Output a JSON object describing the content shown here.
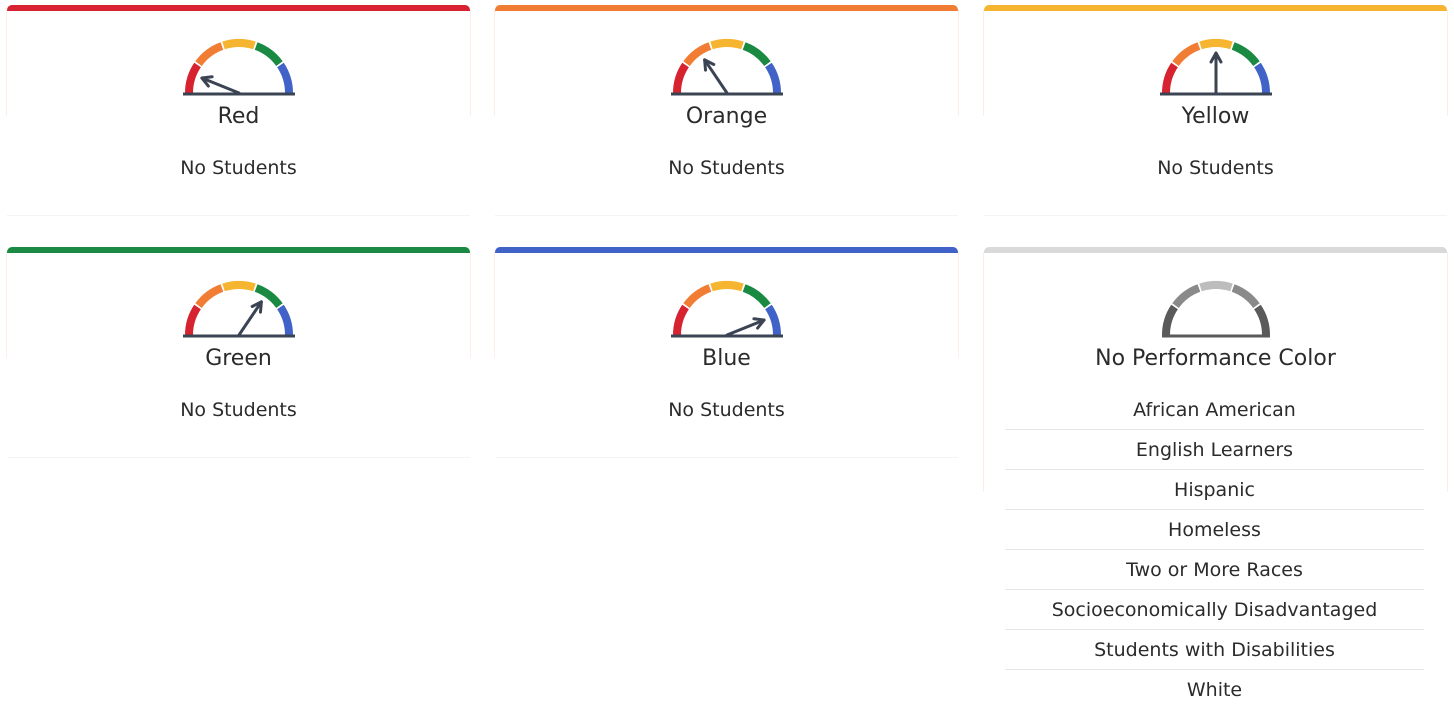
{
  "cards": [
    {
      "label": "Red",
      "status": "No Students",
      "accent": "#d7222f",
      "needle": "red"
    },
    {
      "label": "Orange",
      "status": "No Students",
      "accent": "#f07d33",
      "needle": "orange"
    },
    {
      "label": "Yellow",
      "status": "No Students",
      "accent": "#f6b530",
      "needle": "yellow"
    },
    {
      "label": "Green",
      "status": "No Students",
      "accent": "#1a8a43",
      "needle": "green"
    },
    {
      "label": "Blue",
      "status": "No Students",
      "accent": "#4163c8",
      "needle": "blue"
    },
    {
      "label": "No Performance Color",
      "accent": "#d9d9d9",
      "groups": [
        "African American",
        "English Learners",
        "Hispanic",
        "Homeless",
        "Two or More Races",
        "Socioeconomically Disadvantaged",
        "Students with Disabilities",
        "White"
      ]
    }
  ],
  "gauge_colors": {
    "red": "#d7222f",
    "orange": "#f07d33",
    "yellow": "#f6b530",
    "green": "#1a8a43",
    "blue": "#4163c8",
    "gray_dark": "#5a5a5a",
    "gray_mid": "#8a8a8a",
    "gray_light": "#bdbdbd",
    "needle": "#3b4453",
    "base": "#3b4453"
  }
}
